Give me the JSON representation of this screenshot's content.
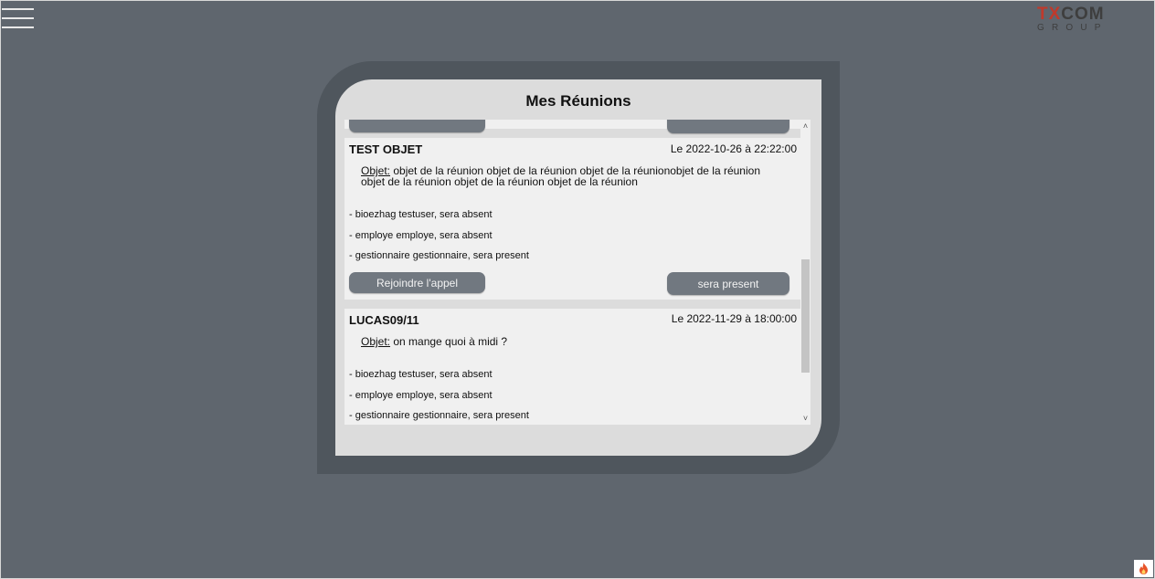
{
  "app": {
    "logo_top_1": "TX",
    "logo_top_2": "COM",
    "logo_bottom": "GROUP"
  },
  "panel": {
    "title": "Mes Réunions"
  },
  "meetings": [
    {
      "title": "",
      "date": "",
      "object_label": "",
      "object_text": "",
      "participants": [],
      "join_label": "",
      "presence_label": ""
    },
    {
      "title": "TEST OBJET",
      "date": "Le 2022-10-26 à 22:22:00",
      "object_label": "Objet:",
      "object_text": " objet de la réunion objet de la réunion objet de la réunionobjet de la réunion objet de la réunion objet de la réunion objet de la réunion",
      "participants": [
        "- bioezhag testuser, sera absent",
        "- employe employe, sera absent",
        "- gestionnaire gestionnaire, sera present"
      ],
      "join_label": "Rejoindre l'appel",
      "presence_label": "sera present"
    },
    {
      "title": "LUCAS09/11",
      "date": "Le 2022-11-29 à 18:00:00",
      "object_label": "Objet:",
      "object_text": " on mange quoi à midi ?",
      "participants": [
        "- bioezhag testuser, sera absent",
        "- employe employe, sera absent",
        "- gestionnaire gestionnaire, sera present"
      ],
      "join_label": "",
      "presence_label": ""
    }
  ],
  "colors": {
    "background": "#5f666e",
    "frame": "#4f565d",
    "panel": "#dcdcdc",
    "card": "#f0f0f0",
    "button": "#717880",
    "logo_red": "#c0392b"
  },
  "icons": {
    "menu": "hamburger-menu-icon",
    "scroll_up": "chevron-up-icon",
    "scroll_down": "chevron-down-icon",
    "corner": "flame-icon"
  }
}
